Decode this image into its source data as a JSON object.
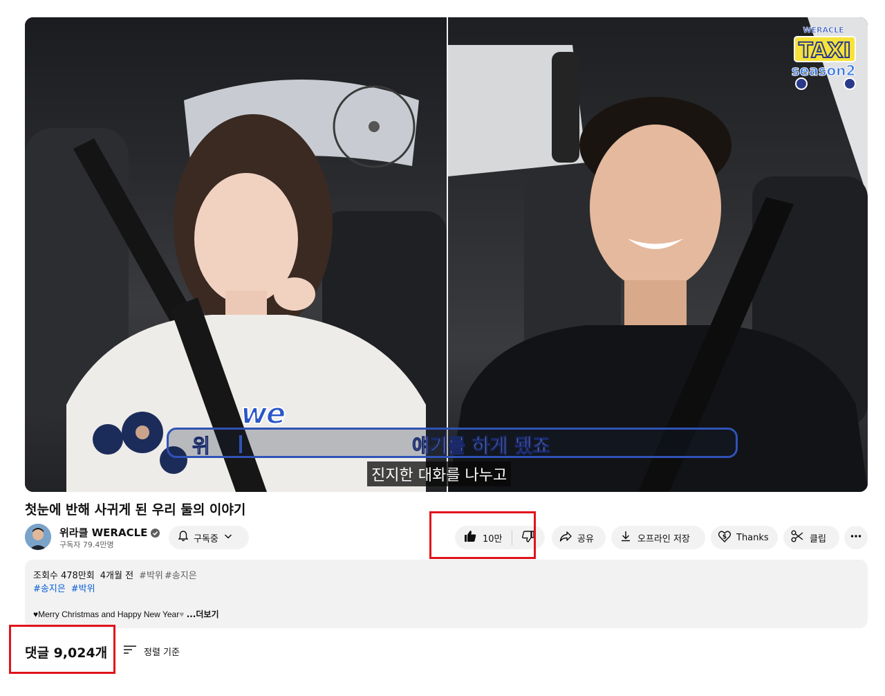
{
  "video": {
    "logo": {
      "brand": "WERACLE",
      "line1": "TAXI",
      "line2": "season2"
    },
    "overlay": {
      "we_mark": "we",
      "caption_left": "위",
      "caption_main": "얘기를 하게 됐죠",
      "subtitle": "진지한 대화를 나누고"
    }
  },
  "title": "첫눈에 반해 사귀게 된 우리 둘의 이야기",
  "channel": {
    "name": "위라클 WERACLE",
    "subscribers": "구독자 79.4만명",
    "subscribe_label": "구독중"
  },
  "actions": {
    "likes": "10만",
    "share": "공유",
    "download": "오프라인 저장",
    "thanks": "Thanks",
    "clip": "클립"
  },
  "description": {
    "views": "조회수 478만회",
    "date": "4개월 전",
    "meta_tags": [
      "#박위",
      "#송지은"
    ],
    "tags": [
      "#송지은",
      "#박위"
    ],
    "text": "♥Merry Christmas and Happy New Year",
    "text_fade": "♥",
    "more": "...더보기"
  },
  "comments": {
    "count": "댓글 9,024개",
    "sort_label": "정렬 기준"
  },
  "colors": {
    "highlight": "#e0131b",
    "link": "#065fd4",
    "pill_bg": "#f2f2f2"
  }
}
